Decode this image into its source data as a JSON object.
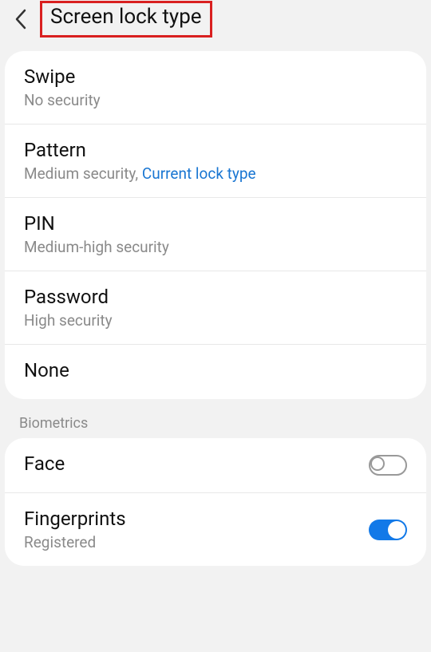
{
  "header": {
    "title": "Screen lock type"
  },
  "lockTypes": [
    {
      "title": "Swipe",
      "desc": "No security",
      "current": false
    },
    {
      "title": "Pattern",
      "desc": "Medium security, ",
      "currentLabel": "Current lock type",
      "current": true
    },
    {
      "title": "PIN",
      "desc": "Medium-high security",
      "current": false
    },
    {
      "title": "Password",
      "desc": "High security",
      "current": false
    },
    {
      "title": "None",
      "desc": "",
      "current": false
    }
  ],
  "biometrics": {
    "sectionLabel": "Biometrics",
    "items": [
      {
        "title": "Face",
        "desc": "",
        "enabled": false
      },
      {
        "title": "Fingerprints",
        "desc": "Registered",
        "enabled": true
      }
    ]
  }
}
